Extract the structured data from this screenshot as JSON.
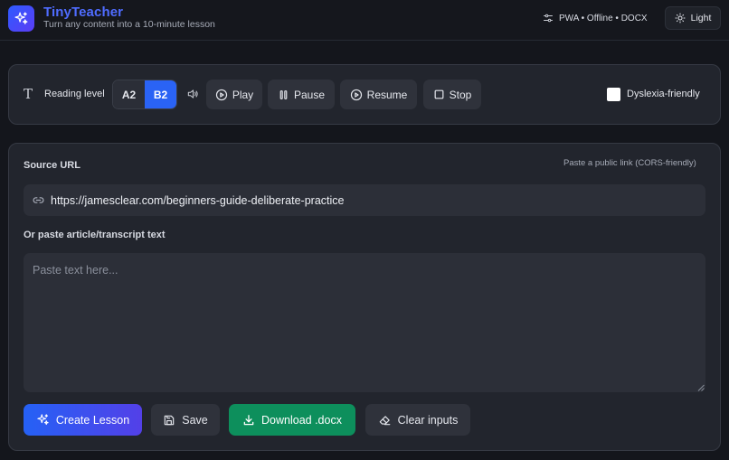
{
  "header": {
    "app_title": "TinyTeacher",
    "tagline": "Turn any content into a 10-minute lesson",
    "status": "PWA • Offline • DOCX",
    "theme_button": "Light"
  },
  "toolbar": {
    "reading_level_label": "Reading level",
    "levels": [
      "A2",
      "B2"
    ],
    "selected_level": "B2",
    "play": "Play",
    "pause": "Pause",
    "resume": "Resume",
    "stop": "Stop",
    "dyslexia_label": "Dyslexia-friendly",
    "dyslexia_checked": false
  },
  "source": {
    "label": "Source URL",
    "hint": "Paste a public link (CORS-friendly)",
    "url_value": "https://jamesclear.com/beginners-guide-deliberate-practice",
    "paste_label": "Or paste article/transcript text",
    "paste_placeholder": "Paste text here..."
  },
  "actions": {
    "create": "Create Lesson",
    "save": "Save",
    "download": "Download .docx",
    "clear": "Clear inputs"
  },
  "colors": {
    "accent": "#2a63f5",
    "brand_title": "#4f6cff",
    "download_green": "#0d8f5c",
    "background": "#14161c",
    "panel": "#22252d"
  }
}
